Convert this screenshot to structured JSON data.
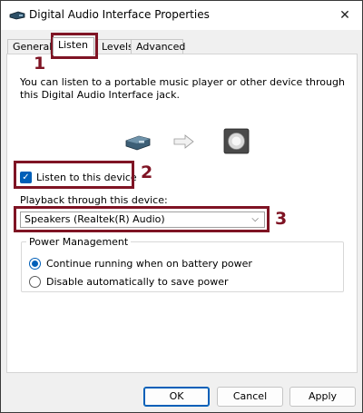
{
  "window": {
    "title": "Digital Audio Interface Properties"
  },
  "titlebar": {
    "close_glyph": "✕"
  },
  "tabs": [
    {
      "label": "General"
    },
    {
      "label": "Listen"
    },
    {
      "label": "Levels"
    },
    {
      "label": "Advanced"
    }
  ],
  "listen": {
    "description": "You can listen to a portable music player or other device through this Digital Audio Interface jack.",
    "listen_checkbox_label": "Listen to this device",
    "listen_checked": true,
    "playback_label": "Playback through this device:",
    "playback_selected": "Speakers (Realtek(R) Audio)"
  },
  "power": {
    "title": "Power Management",
    "options": [
      {
        "label": "Continue running when on battery power",
        "selected": true
      },
      {
        "label": "Disable automatically to save power",
        "selected": false
      }
    ]
  },
  "buttons": {
    "ok": "OK",
    "cancel": "Cancel",
    "apply": "Apply"
  },
  "callouts": {
    "one": "1",
    "two": "2",
    "three": "3"
  },
  "icons": {
    "title_icon": "audio-device-icon",
    "device_source": "audio-jack-device-icon",
    "arrow": "arrow-right-icon",
    "speaker": "speaker-icon"
  },
  "colors": {
    "accent": "#005fb8",
    "callout": "#7f1424"
  }
}
